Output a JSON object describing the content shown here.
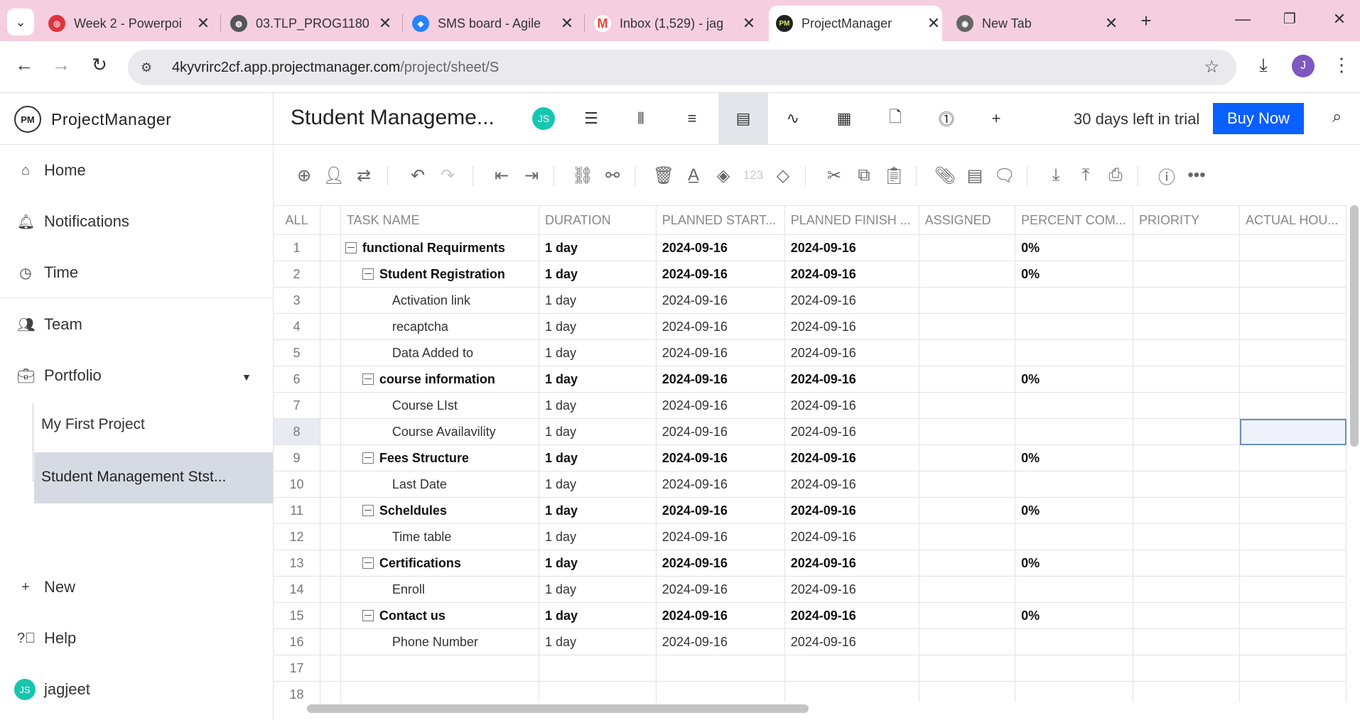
{
  "browser": {
    "tabs": [
      {
        "title": "Week 2 - Powerpoi",
        "favicon": "powerpoint-icon",
        "color": "#e0343d",
        "glyph": "◎"
      },
      {
        "title": "03.TLP_PROG1180",
        "favicon": "globe-icon",
        "color": "#555555",
        "glyph": "◍"
      },
      {
        "title": "SMS board - Agile",
        "favicon": "jira-icon",
        "color": "#2684ff",
        "glyph": "◆"
      },
      {
        "title": "Inbox (1,529) - jag",
        "favicon": "gmail-icon",
        "color": "#ea4335",
        "glyph": "M"
      },
      {
        "title": "ProjectManager",
        "favicon": "projectmanager-icon",
        "color": "#222222",
        "glyph": "PM"
      },
      {
        "title": "New Tab",
        "favicon": "chrome-icon",
        "color": "#666666",
        "glyph": "◉"
      }
    ],
    "url_host": "4kyvrirc2cf.app.projectmanager.com",
    "url_path": "/project/sheet/S",
    "profile_initial": "J"
  },
  "sidebar": {
    "brand": "ProjectManager",
    "brand_mark": "PM",
    "items": [
      {
        "label": "Home"
      },
      {
        "label": "Notifications"
      },
      {
        "label": "Time"
      },
      {
        "label": "Team"
      },
      {
        "label": "Portfolio"
      }
    ],
    "projects": [
      {
        "label": "My First Project"
      },
      {
        "label": "Student Management Stst..."
      }
    ],
    "new_label": "New",
    "help_label": "Help",
    "user_initials": "JS",
    "user_name": "jagjeet"
  },
  "header": {
    "project_title": "Student Manageme...",
    "avatar_initials": "JS",
    "trial_text": "30 days left in trial",
    "buy_label": "Buy Now",
    "accent": "#0a5fff"
  },
  "toolbar": {
    "number_format_label": "123"
  },
  "grid": {
    "columns": [
      "ALL",
      "",
      "TASK NAME",
      "DURATION",
      "PLANNED START...",
      "PLANNED FINISH ...",
      "ASSIGNED",
      "PERCENT COM...",
      "PRIORITY",
      "ACTUAL HOU..."
    ],
    "rows": [
      {
        "num": "1",
        "name": "functional Requirments",
        "duration": "1 day",
        "start": "2024-09-16",
        "finish": "2024-09-16",
        "assigned": "",
        "percent": "0%",
        "priority": "",
        "actual": ""
      },
      {
        "num": "2",
        "name": "Student Registration",
        "duration": "1 day",
        "start": "2024-09-16",
        "finish": "2024-09-16",
        "assigned": "",
        "percent": "0%",
        "priority": "",
        "actual": ""
      },
      {
        "num": "3",
        "name": "Activation link",
        "duration": "1 day",
        "start": "2024-09-16",
        "finish": "2024-09-16",
        "assigned": "",
        "percent": "",
        "priority": "",
        "actual": ""
      },
      {
        "num": "4",
        "name": "recaptcha",
        "duration": "1 day",
        "start": "2024-09-16",
        "finish": "2024-09-16",
        "assigned": "",
        "percent": "",
        "priority": "",
        "actual": ""
      },
      {
        "num": "5",
        "name": "Data Added to",
        "duration": "1 day",
        "start": "2024-09-16",
        "finish": "2024-09-16",
        "assigned": "",
        "percent": "",
        "priority": "",
        "actual": ""
      },
      {
        "num": "6",
        "name": "course information",
        "duration": "1 day",
        "start": "2024-09-16",
        "finish": "2024-09-16",
        "assigned": "",
        "percent": "0%",
        "priority": "",
        "actual": ""
      },
      {
        "num": "7",
        "name": "Course LIst",
        "duration": "1 day",
        "start": "2024-09-16",
        "finish": "2024-09-16",
        "assigned": "",
        "percent": "",
        "priority": "",
        "actual": ""
      },
      {
        "num": "8",
        "name": "Course Availavility",
        "duration": "1 day",
        "start": "2024-09-16",
        "finish": "2024-09-16",
        "assigned": "",
        "percent": "",
        "priority": "",
        "actual": ""
      },
      {
        "num": "9",
        "name": "Fees Structure",
        "duration": "1 day",
        "start": "2024-09-16",
        "finish": "2024-09-16",
        "assigned": "",
        "percent": "0%",
        "priority": "",
        "actual": ""
      },
      {
        "num": "10",
        "name": "Last Date",
        "duration": "1 day",
        "start": "2024-09-16",
        "finish": "2024-09-16",
        "assigned": "",
        "percent": "",
        "priority": "",
        "actual": ""
      },
      {
        "num": "11",
        "name": "Scheldules",
        "duration": "1 day",
        "start": "2024-09-16",
        "finish": "2024-09-16",
        "assigned": "",
        "percent": "0%",
        "priority": "",
        "actual": ""
      },
      {
        "num": "12",
        "name": "Time table",
        "duration": "1 day",
        "start": "2024-09-16",
        "finish": "2024-09-16",
        "assigned": "",
        "percent": "",
        "priority": "",
        "actual": ""
      },
      {
        "num": "13",
        "name": "Certifications",
        "duration": "1 day",
        "start": "2024-09-16",
        "finish": "2024-09-16",
        "assigned": "",
        "percent": "0%",
        "priority": "",
        "actual": ""
      },
      {
        "num": "14",
        "name": "Enroll",
        "duration": "1 day",
        "start": "2024-09-16",
        "finish": "2024-09-16",
        "assigned": "",
        "percent": "",
        "priority": "",
        "actual": ""
      },
      {
        "num": "15",
        "name": "Contact us",
        "duration": "1 day",
        "start": "2024-09-16",
        "finish": "2024-09-16",
        "assigned": "",
        "percent": "0%",
        "priority": "",
        "actual": ""
      },
      {
        "num": "16",
        "name": "Phone Number",
        "duration": "1 day",
        "start": "2024-09-16",
        "finish": "2024-09-16",
        "assigned": "",
        "percent": "",
        "priority": "",
        "actual": ""
      },
      {
        "num": "17",
        "name": "",
        "duration": "",
        "start": "",
        "finish": "",
        "assigned": "",
        "percent": "",
        "priority": "",
        "actual": ""
      },
      {
        "num": "18",
        "name": "",
        "duration": "",
        "start": "",
        "finish": "",
        "assigned": "",
        "percent": "",
        "priority": "",
        "actual": ""
      }
    ]
  }
}
